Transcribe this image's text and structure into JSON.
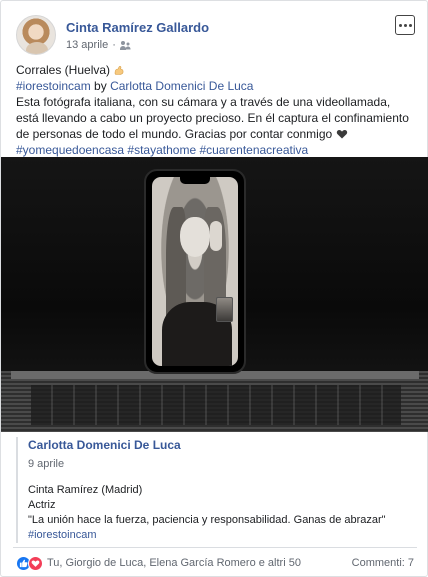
{
  "post": {
    "author": "Cinta Ramírez Gallardo",
    "date": "13 aprile",
    "date_separator": "·",
    "audience_icon": "friends-icon",
    "location_line": "Corrales (Huelva)",
    "hashtag_line": "#iorestoincam",
    "by_word": "by",
    "tagged_person": "Carlotta Domenici De Luca",
    "body_text": "Esta fotógrafa italiana, con su cámara y a través de una videollamada, está llevando a cabo un proyecto precioso. En él captura el confinamiento de personas de todo el mundo. Gracias por contar conmigo",
    "hashtags_footer": "#yomequedoencasa #stayathome #cuarentenacreativa"
  },
  "attached_post": {
    "author": "Carlotta Domenici De Luca",
    "date": "9 aprile",
    "line1": "Cinta Ramírez (Madrid)",
    "line2": "Actriz",
    "line3": "\"La unión hace la fuerza, paciencia y responsabilidad. Ganas de abrazar\"",
    "line4": "#iorestoincam"
  },
  "footer": {
    "reactions_text": "Tu, Giorgio de Luca, Elena García Romero e altri 50",
    "comments_text": "Commenti: 7"
  },
  "colors": {
    "link": "#385898",
    "like": "#1877f2",
    "love": "#f33e58"
  }
}
